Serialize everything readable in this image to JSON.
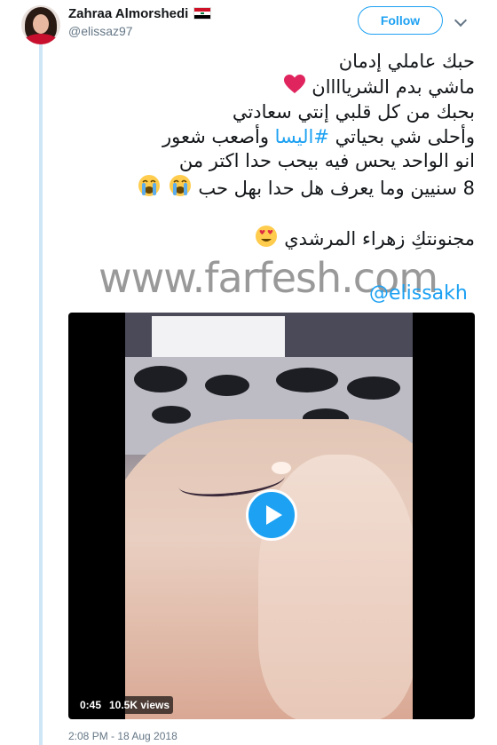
{
  "user": {
    "display_name": "Zahraa Almorshedi",
    "handle": "@elissaz97",
    "flag_icon": "iraq-flag-icon"
  },
  "actions": {
    "follow_label": "Follow",
    "menu_icon": "chevron-down-icon"
  },
  "tweet": {
    "lines": [
      {
        "text": "حبك عاملي إدمان"
      },
      {
        "text": "ماشي بدم الشرياااان",
        "emoji": "red-heart"
      },
      {
        "text": "بحبك من كل قلبي إنتي سعادتي"
      },
      {
        "before": "وأحلى شي بحياتي ",
        "hashtag": "#اليسا",
        "after": " وأصعب شعور"
      },
      {
        "text": "انو الواحد يحس فيه بيحب حدا اكتر من"
      },
      {
        "text": "8 سنيين وما يعرف هل حدا بهل حب",
        "emoji": "loudly-crying-face x2"
      },
      {
        "text": "مجنونتكِ زهراء المرشدي",
        "emoji": "smiling-face-with-heart-eyes"
      }
    ]
  },
  "watermark": {
    "site": "www.farfesh.com",
    "handle": "@elissakh"
  },
  "video": {
    "duration": "0:45",
    "views": "10.5K views",
    "play_icon": "play-icon"
  },
  "meta": {
    "timestamp": "2:08 PM - 18 Aug 2018"
  },
  "colors": {
    "accent": "#1da1f2",
    "text": "#14171a",
    "secondary": "#657786",
    "thread_line": "#cfe6f7",
    "heart": "#e0245e"
  }
}
